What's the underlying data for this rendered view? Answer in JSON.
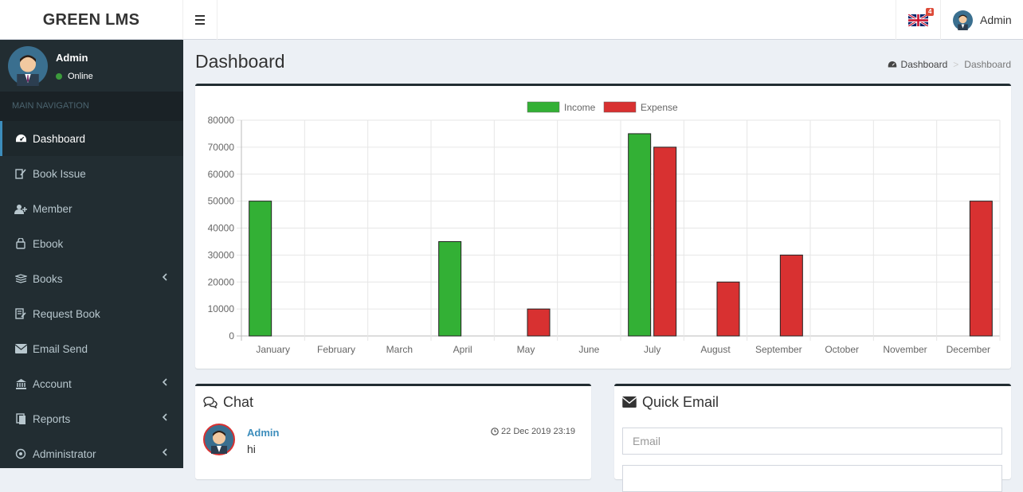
{
  "app": {
    "logo": "GREEN LMS"
  },
  "header": {
    "flag_badge": "4",
    "user_name": "Admin"
  },
  "sidebar": {
    "user": {
      "name": "Admin",
      "status": "Online"
    },
    "nav_header": "MAIN NAVIGATION",
    "items": [
      {
        "label": "Dashboard",
        "icon": "dashboard-icon",
        "active": true
      },
      {
        "label": "Book Issue",
        "icon": "book-issue-icon"
      },
      {
        "label": "Member",
        "icon": "user-plus-icon"
      },
      {
        "label": "Ebook",
        "icon": "ebook-icon"
      },
      {
        "label": "Books",
        "icon": "books-icon",
        "has_children": true
      },
      {
        "label": "Request Book",
        "icon": "request-book-icon"
      },
      {
        "label": "Email Send",
        "icon": "envelope-icon"
      },
      {
        "label": "Account",
        "icon": "account-icon",
        "has_children": true
      },
      {
        "label": "Reports",
        "icon": "reports-icon",
        "has_children": true
      },
      {
        "label": "Administrator",
        "icon": "administrator-icon",
        "has_children": true
      }
    ]
  },
  "page": {
    "title": "Dashboard",
    "breadcrumb": {
      "home": "Dashboard",
      "current": "Dashboard"
    }
  },
  "chart_data": {
    "type": "bar",
    "categories": [
      "January",
      "February",
      "March",
      "April",
      "May",
      "June",
      "July",
      "August",
      "September",
      "October",
      "November",
      "December"
    ],
    "series": [
      {
        "name": "Income",
        "color": "#33b035",
        "values": [
          50000,
          0,
          0,
          35000,
          0,
          0,
          75000,
          0,
          0,
          0,
          0,
          0
        ]
      },
      {
        "name": "Expense",
        "color": "#d83131",
        "values": [
          0,
          0,
          0,
          0,
          10000,
          0,
          70000,
          20000,
          30000,
          0,
          0,
          50000
        ]
      }
    ],
    "ylim": [
      0,
      80000
    ],
    "yticks": [
      0,
      10000,
      20000,
      30000,
      40000,
      50000,
      60000,
      70000,
      80000
    ],
    "grid": true,
    "legend_position": "top-center"
  },
  "chat": {
    "title": "Chat",
    "messages": [
      {
        "author": "Admin",
        "time": "22 Dec 2019 23:19",
        "text": "hi"
      }
    ]
  },
  "quick_email": {
    "title": "Quick Email",
    "email_placeholder": "Email"
  }
}
